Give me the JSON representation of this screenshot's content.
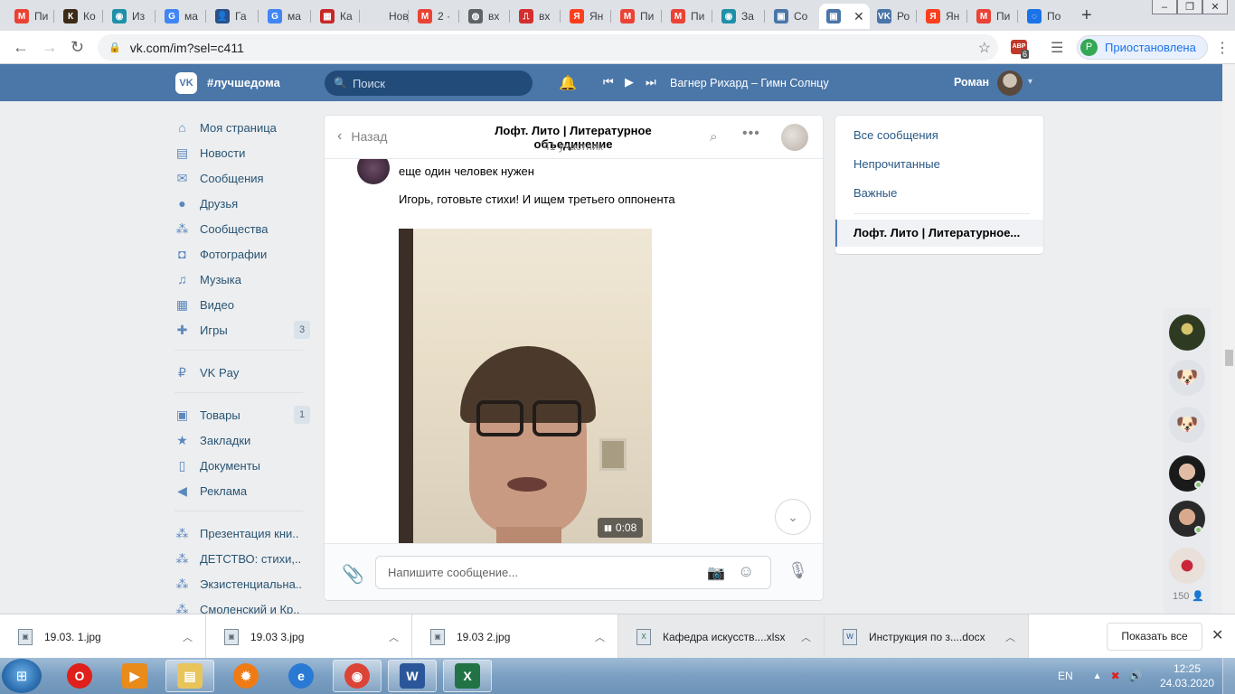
{
  "browser": {
    "tabs": [
      {
        "label": "Пи",
        "icon": "gmail-icon",
        "color": "#ea4335",
        "glyph": "M"
      },
      {
        "label": "Ко",
        "icon": "app-icon",
        "color": "#3b2a16",
        "glyph": "К"
      },
      {
        "label": "Из",
        "icon": "eye-icon",
        "color": "#1e90a8",
        "glyph": "◉"
      },
      {
        "label": "ма",
        "icon": "google-icon",
        "color": "#4285f4",
        "glyph": "G"
      },
      {
        "label": "Га",
        "icon": "person-icon",
        "color": "#2a4f8a",
        "glyph": "👤"
      },
      {
        "label": "ма",
        "icon": "google-icon",
        "color": "#4285f4",
        "glyph": "G"
      },
      {
        "label": "Ка",
        "icon": "calendar-icon",
        "color": "#c62828",
        "glyph": "▦"
      },
      {
        "label": "Новая",
        "icon": "blank-icon",
        "color": "#dee1e6",
        "glyph": ""
      },
      {
        "label": "2 ·",
        "icon": "gmail-icon",
        "color": "#ea4335",
        "glyph": "M"
      },
      {
        "label": "вх",
        "icon": "globe-icon",
        "color": "#5f6368",
        "glyph": "◍"
      },
      {
        "label": "вх",
        "icon": "pdf-icon",
        "color": "#d32f2f",
        "glyph": "⎍"
      },
      {
        "label": "Ян",
        "icon": "yandex-icon",
        "color": "#fc3f1d",
        "glyph": "Я"
      },
      {
        "label": "Пи",
        "icon": "gmail-icon",
        "color": "#ea4335",
        "glyph": "M"
      },
      {
        "label": "Пи",
        "icon": "gmail-icon",
        "color": "#ea4335",
        "glyph": "M"
      },
      {
        "label": "За",
        "icon": "eye-icon",
        "color": "#1e90a8",
        "glyph": "◉"
      },
      {
        "label": "Со",
        "icon": "chat-icon",
        "color": "#4a76a8",
        "glyph": "▣"
      },
      {
        "label": "",
        "icon": "chat-icon",
        "color": "#4a76a8",
        "glyph": "▣"
      },
      {
        "label": "Ро",
        "icon": "vk-icon",
        "color": "#4a76a8",
        "glyph": "VK"
      },
      {
        "label": "Ян",
        "icon": "yandex-icon",
        "color": "#fc3f1d",
        "glyph": "Я"
      },
      {
        "label": "Пи",
        "icon": "gmail-icon",
        "color": "#ea4335",
        "glyph": "M"
      },
      {
        "label": "По",
        "icon": "ring-icon",
        "color": "#1a73e8",
        "glyph": "◌"
      }
    ],
    "active_tab_index": 16,
    "close_glyph": "✕",
    "new_tab_glyph": "+",
    "window_controls": [
      "–",
      "❐",
      "✕"
    ],
    "url": "vk.com/im?sel=c411",
    "adblock_label": "ABP",
    "adblock_count": "6",
    "profile_initial": "P",
    "profile_status": "Приостановлена"
  },
  "vk": {
    "header": {
      "tagline": "#лучшедома",
      "search_placeholder": "Поиск",
      "track": "Вагнер Рихард – Гимн Солнцу",
      "user_name": "Роман"
    },
    "menu": [
      {
        "label": "Моя страница",
        "icon": "home-icon",
        "glyph": "⌂",
        "badge": ""
      },
      {
        "label": "Новости",
        "icon": "news-icon",
        "glyph": "▤",
        "badge": ""
      },
      {
        "label": "Сообщения",
        "icon": "message-icon",
        "glyph": "✉",
        "badge": ""
      },
      {
        "label": "Друзья",
        "icon": "friend-icon",
        "glyph": "●",
        "badge": ""
      },
      {
        "label": "Сообщества",
        "icon": "group-icon",
        "glyph": "⁂",
        "badge": ""
      },
      {
        "label": "Фотографии",
        "icon": "camera-icon",
        "glyph": "◘",
        "badge": ""
      },
      {
        "label": "Музыка",
        "icon": "music-icon",
        "glyph": "♫",
        "badge": ""
      },
      {
        "label": "Видео",
        "icon": "film-icon",
        "glyph": "▦",
        "badge": ""
      },
      {
        "label": "Игры",
        "icon": "gamepad-icon",
        "glyph": "✚",
        "badge": "3"
      },
      {
        "label": "VK Pay",
        "icon": "pay-icon",
        "glyph": "₽",
        "badge": ""
      },
      {
        "label": "Товары",
        "icon": "bag-icon",
        "glyph": "▣",
        "badge": "1"
      },
      {
        "label": "Закладки",
        "icon": "star-icon",
        "glyph": "★",
        "badge": ""
      },
      {
        "label": "Документы",
        "icon": "document-icon",
        "glyph": "▯",
        "badge": ""
      },
      {
        "label": "Реклама",
        "icon": "megaphone-icon",
        "glyph": "◀",
        "badge": ""
      },
      {
        "label": "Презентация кни..",
        "icon": "group-icon",
        "glyph": "⁂",
        "badge": ""
      },
      {
        "label": "ДЕТСТВО: стихи,..",
        "icon": "group-icon",
        "glyph": "⁂",
        "badge": ""
      },
      {
        "label": "Экзистенциальна..",
        "icon": "group-icon",
        "glyph": "⁂",
        "badge": ""
      },
      {
        "label": "Смоленский и Кр..",
        "icon": "group-icon",
        "glyph": "⁂",
        "badge": ""
      }
    ],
    "chat": {
      "back_label": "Назад",
      "title": "Лофт. Лито | Литературное объединение",
      "members": "41 участник",
      "messages": [
        "еще один человек нужен",
        "Игорь, готовьте стихи! И ищем третьего оппонента"
      ],
      "video_duration": "0:08",
      "input_placeholder": "Напишите сообщение..."
    },
    "filters": {
      "items": [
        "Все сообщения",
        "Непрочитанные",
        "Важные"
      ],
      "active_conversation": "Лофт. Лито | Литературное..."
    },
    "friends_count": "150"
  },
  "downloads": {
    "items": [
      {
        "name": "19.03. 1.jpg",
        "type": "jpg"
      },
      {
        "name": "19.03 3.jpg",
        "type": "jpg"
      },
      {
        "name": "19.03 2.jpg",
        "type": "jpg"
      },
      {
        "name": "Кафедра искусств....xlsx",
        "type": "xlsx"
      },
      {
        "name": "Инструкция по з....docx",
        "type": "docx"
      }
    ],
    "show_all": "Показать все"
  },
  "taskbar": {
    "apps": [
      {
        "name": "opera",
        "color": "#e0201b",
        "glyph": "O",
        "open": false
      },
      {
        "name": "media-player",
        "color": "#e88b1a",
        "glyph": "▶",
        "open": false
      },
      {
        "name": "explorer",
        "color": "#e8c45b",
        "glyph": "▤",
        "open": true
      },
      {
        "name": "settings",
        "color": "#f07a14",
        "glyph": "✹",
        "open": false
      },
      {
        "name": "internet-explorer",
        "color": "#2a7ad4",
        "glyph": "e",
        "open": false
      },
      {
        "name": "chrome",
        "color": "#db4437",
        "glyph": "◉",
        "open": true
      },
      {
        "name": "word",
        "color": "#2b579a",
        "glyph": "W",
        "open": true
      },
      {
        "name": "excel",
        "color": "#217346",
        "glyph": "X",
        "open": true
      }
    ],
    "language": "EN",
    "time": "12:25",
    "date": "24.03.2020"
  }
}
